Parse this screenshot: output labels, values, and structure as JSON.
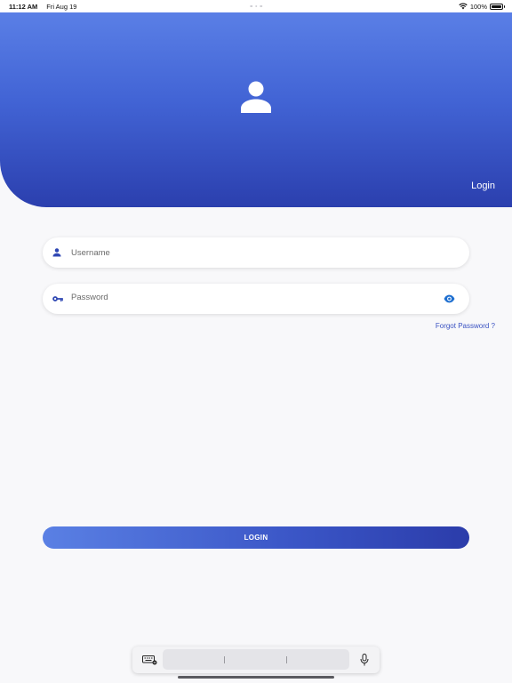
{
  "status_bar": {
    "time": "11:12 AM",
    "date": "Fri Aug 19",
    "battery": "100%",
    "battery_level": 1.0,
    "icons": [
      "wifi-icon",
      "battery-icon"
    ]
  },
  "header": {
    "title": "Login",
    "icon": "person-icon",
    "gradient_colors": [
      "#5a7fe6",
      "#2b3fae"
    ]
  },
  "form": {
    "username": {
      "placeholder": "Username",
      "value": "",
      "icon": "person-icon"
    },
    "password": {
      "placeholder": "Password",
      "value": "",
      "icon": "key-icon",
      "toggle_icon": "eye-icon"
    },
    "forgot_label": "Forgot Password ?"
  },
  "login_button": {
    "label": "LOGIN"
  },
  "colors": {
    "accent": "#3a52c2",
    "icon_accent": "#1e6fd0",
    "background": "#f8f8fa"
  },
  "keyboard_bar": {
    "icons": [
      "keyboard-icon",
      "microphone-icon"
    ]
  }
}
